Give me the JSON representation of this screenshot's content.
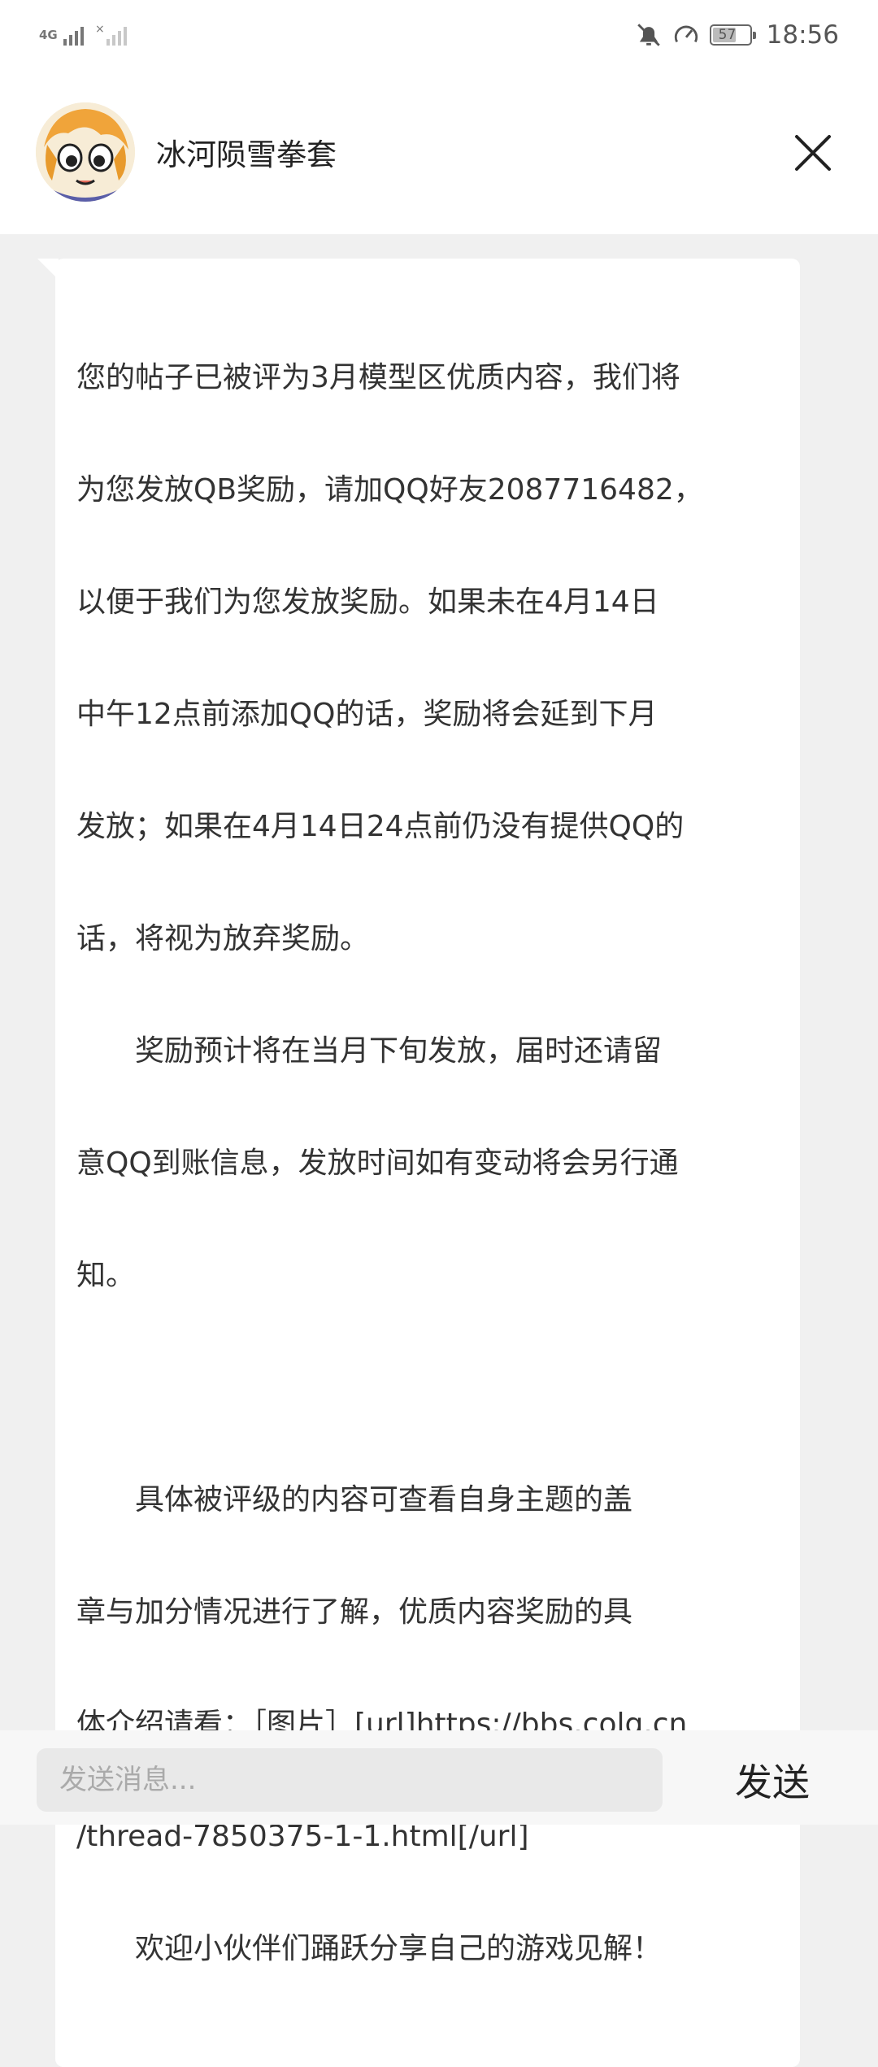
{
  "status_bar": {
    "network_label": "4G",
    "battery_level": "57",
    "time": "18:56"
  },
  "header": {
    "contact_name": "冰河陨雪拳套"
  },
  "message": {
    "lines": [
      "您的帖子已被评为3月模型区优质内容，我们将",
      "为您发放QB奖励，请加QQ好友2087716482，",
      "以便于我们为您发放奖励。如果未在4月14日",
      "中午12点前添加QQ的话，奖励将会延到下月",
      "发放；如果在4月14日24点前仍没有提供QQ的",
      "话，将视为放弃奖励。",
      "　　奖励预计将在当月下旬发放，届时还请留",
      "意QQ到账信息，发放时间如有变动将会另行通",
      "知。",
      "",
      "　　具体被评级的内容可查看自身主题的盖",
      "章与加分情况进行了解，优质内容奖励的具",
      "体介绍请看：［图片］[url]https://bbs.colg.cn",
      "/thread-7850375-1-1.html[/url]",
      "　　欢迎小伙伴们踊跃分享自己的游戏见解！"
    ]
  },
  "input_bar": {
    "placeholder": "发送消息...",
    "send_label": "发送"
  }
}
